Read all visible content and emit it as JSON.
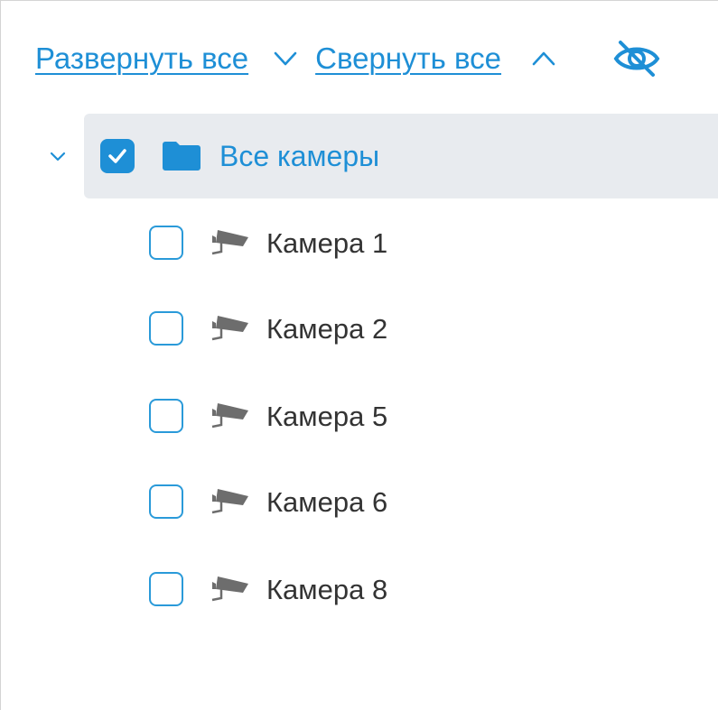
{
  "toolbar": {
    "expand_all": "Развернуть все",
    "collapse_all": "Свернуть все",
    "expand_icon": "chevron-down-icon",
    "collapse_icon": "chevron-up-icon",
    "visibility_icon": "eye-off-icon"
  },
  "tree": {
    "root": {
      "label": "Все камеры",
      "checked": true,
      "expanded": true,
      "icon": "folder-icon"
    },
    "cameras": [
      {
        "label": "Камера 1",
        "checked": false,
        "icon": "camera-icon"
      },
      {
        "label": "Камера 2",
        "checked": false,
        "icon": "camera-icon"
      },
      {
        "label": "Камера 5",
        "checked": false,
        "icon": "camera-icon"
      },
      {
        "label": "Камера 6",
        "checked": false,
        "icon": "camera-icon"
      },
      {
        "label": "Камера 8",
        "checked": false,
        "icon": "camera-icon"
      }
    ]
  },
  "colors": {
    "accent": "#1e8fd6",
    "selected_row_bg": "#e8ebef",
    "text": "#333333",
    "icon_gray": "#6d6d6d"
  }
}
